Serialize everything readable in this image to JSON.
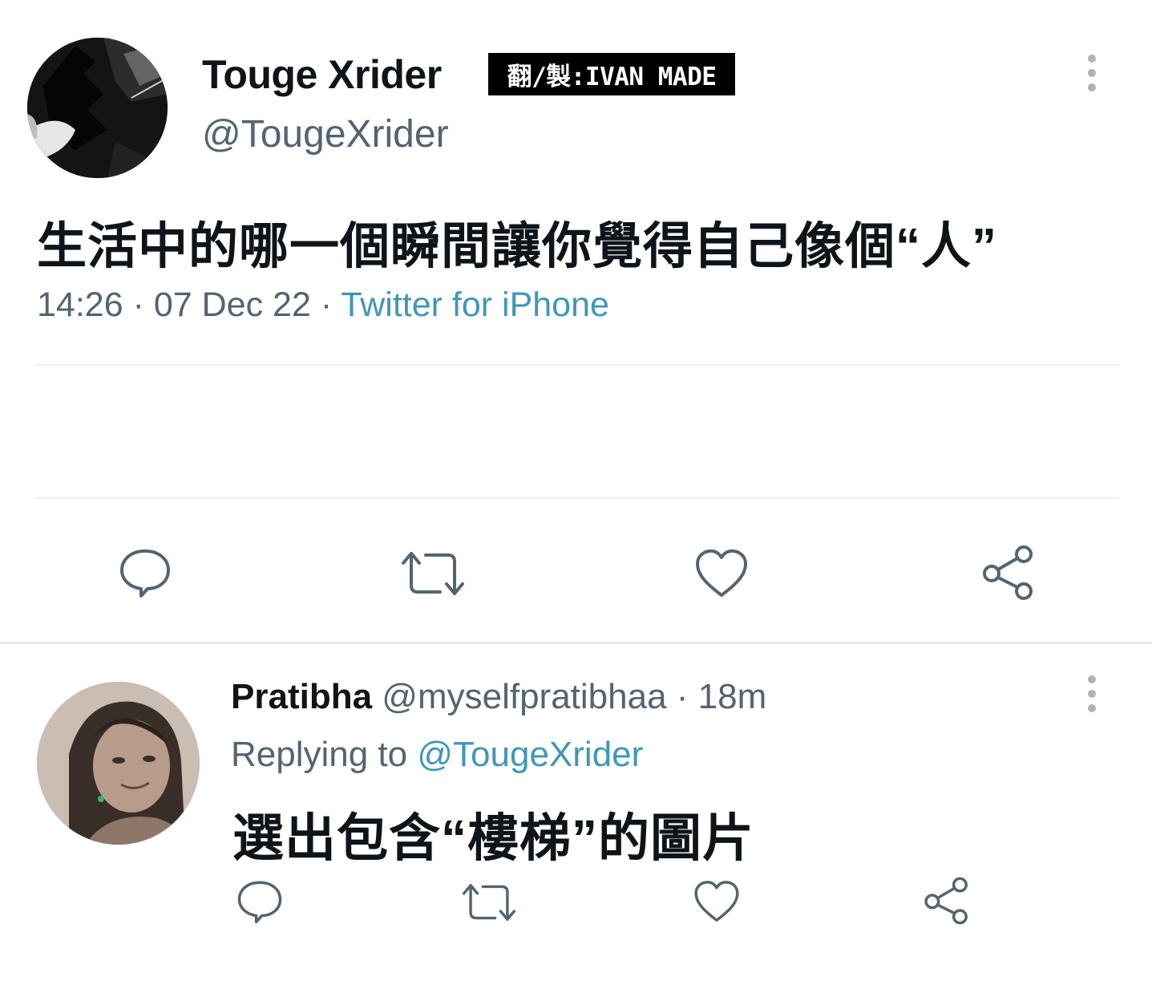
{
  "main_tweet": {
    "display_name": "Touge Xrider",
    "credit_badge": "翻/製:IVAN MADE",
    "handle": "@TougeXrider",
    "text": "生活中的哪一個瞬間讓你覺得自己像個“人”",
    "time": "14:26",
    "date": "07 Dec 22",
    "source": "Twitter for iPhone",
    "separator": "·"
  },
  "reply_tweet": {
    "display_name": "Pratibha",
    "handle": "@myselfpratibhaa",
    "separator": "·",
    "age": "18m",
    "replying_prefix": "Replying to",
    "replying_to": "@TougeXrider",
    "text": "選出包含“樓梯”的圖片"
  },
  "icons": {
    "reply": "reply-icon",
    "retweet": "retweet-icon",
    "like": "heart-icon",
    "share": "share-icon",
    "more": "more-icon"
  },
  "colors": {
    "text_primary": "#0f1419",
    "text_secondary": "#536471",
    "link": "#3f97b8",
    "badge_bg": "#000000"
  }
}
